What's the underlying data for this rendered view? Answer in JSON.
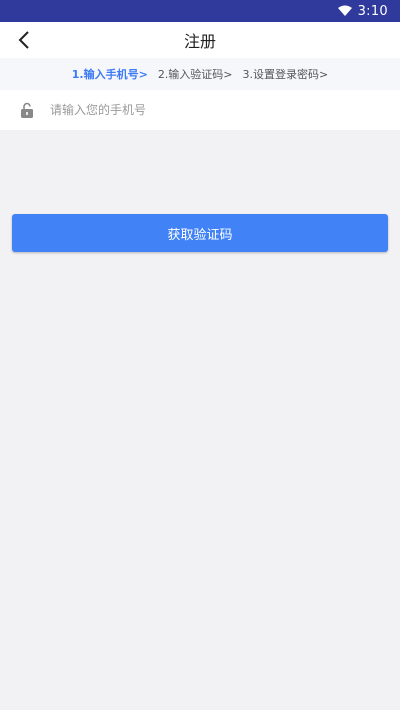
{
  "status_bar": {
    "time": "3:10"
  },
  "app_bar": {
    "title": "注册"
  },
  "steps": [
    {
      "label": "1.输入手机号>"
    },
    {
      "label": "2.输入验证码>"
    },
    {
      "label": "3.设置登录密码>"
    }
  ],
  "phone": {
    "placeholder": "请输入您的手机号",
    "value": ""
  },
  "actions": {
    "get_code_label": "获取验证码"
  },
  "colors": {
    "accent": "#4183f7",
    "status_bar": "#2f3a9c",
    "active_step": "#3d7bf5"
  }
}
